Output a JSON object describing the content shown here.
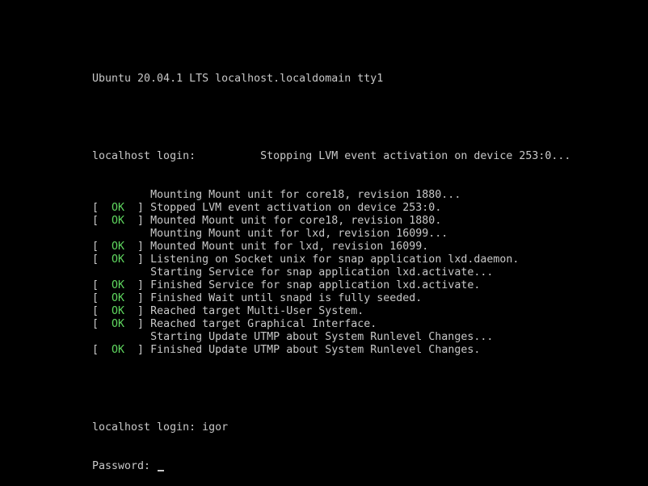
{
  "header": {
    "banner": "Ubuntu 20.04.1 LTS localhost.localdomain tty1"
  },
  "boot": {
    "login_prompt": "localhost login:",
    "login_interleaved_msg": "Stopping LVM event activation on device 253:0...",
    "lines": [
      {
        "status": "",
        "text": "Mounting Mount unit for core18, revision 1880..."
      },
      {
        "status": "OK",
        "text": "Stopped LVM event activation on device 253:0."
      },
      {
        "status": "OK",
        "text": "Mounted Mount unit for core18, revision 1880."
      },
      {
        "status": "",
        "text": "Mounting Mount unit for lxd, revision 16099..."
      },
      {
        "status": "OK",
        "text": "Mounted Mount unit for lxd, revision 16099."
      },
      {
        "status": "OK",
        "text": "Listening on Socket unix for snap application lxd.daemon."
      },
      {
        "status": "",
        "text": "Starting Service for snap application lxd.activate..."
      },
      {
        "status": "OK",
        "text": "Finished Service for snap application lxd.activate."
      },
      {
        "status": "OK",
        "text": "Finished Wait until snapd is fully seeded."
      },
      {
        "status": "OK",
        "text": "Reached target Multi-User System."
      },
      {
        "status": "OK",
        "text": "Reached target Graphical Interface."
      },
      {
        "status": "",
        "text": "Starting Update UTMP about System Runlevel Changes..."
      },
      {
        "status": "OK",
        "text": "Finished Update UTMP about System Runlevel Changes."
      }
    ]
  },
  "login": {
    "prompt": "localhost login:",
    "username": "igor",
    "password_prompt": "Password:"
  },
  "colors": {
    "background": "#000000",
    "text": "#c8c8c8",
    "ok": "#5fd75f"
  }
}
